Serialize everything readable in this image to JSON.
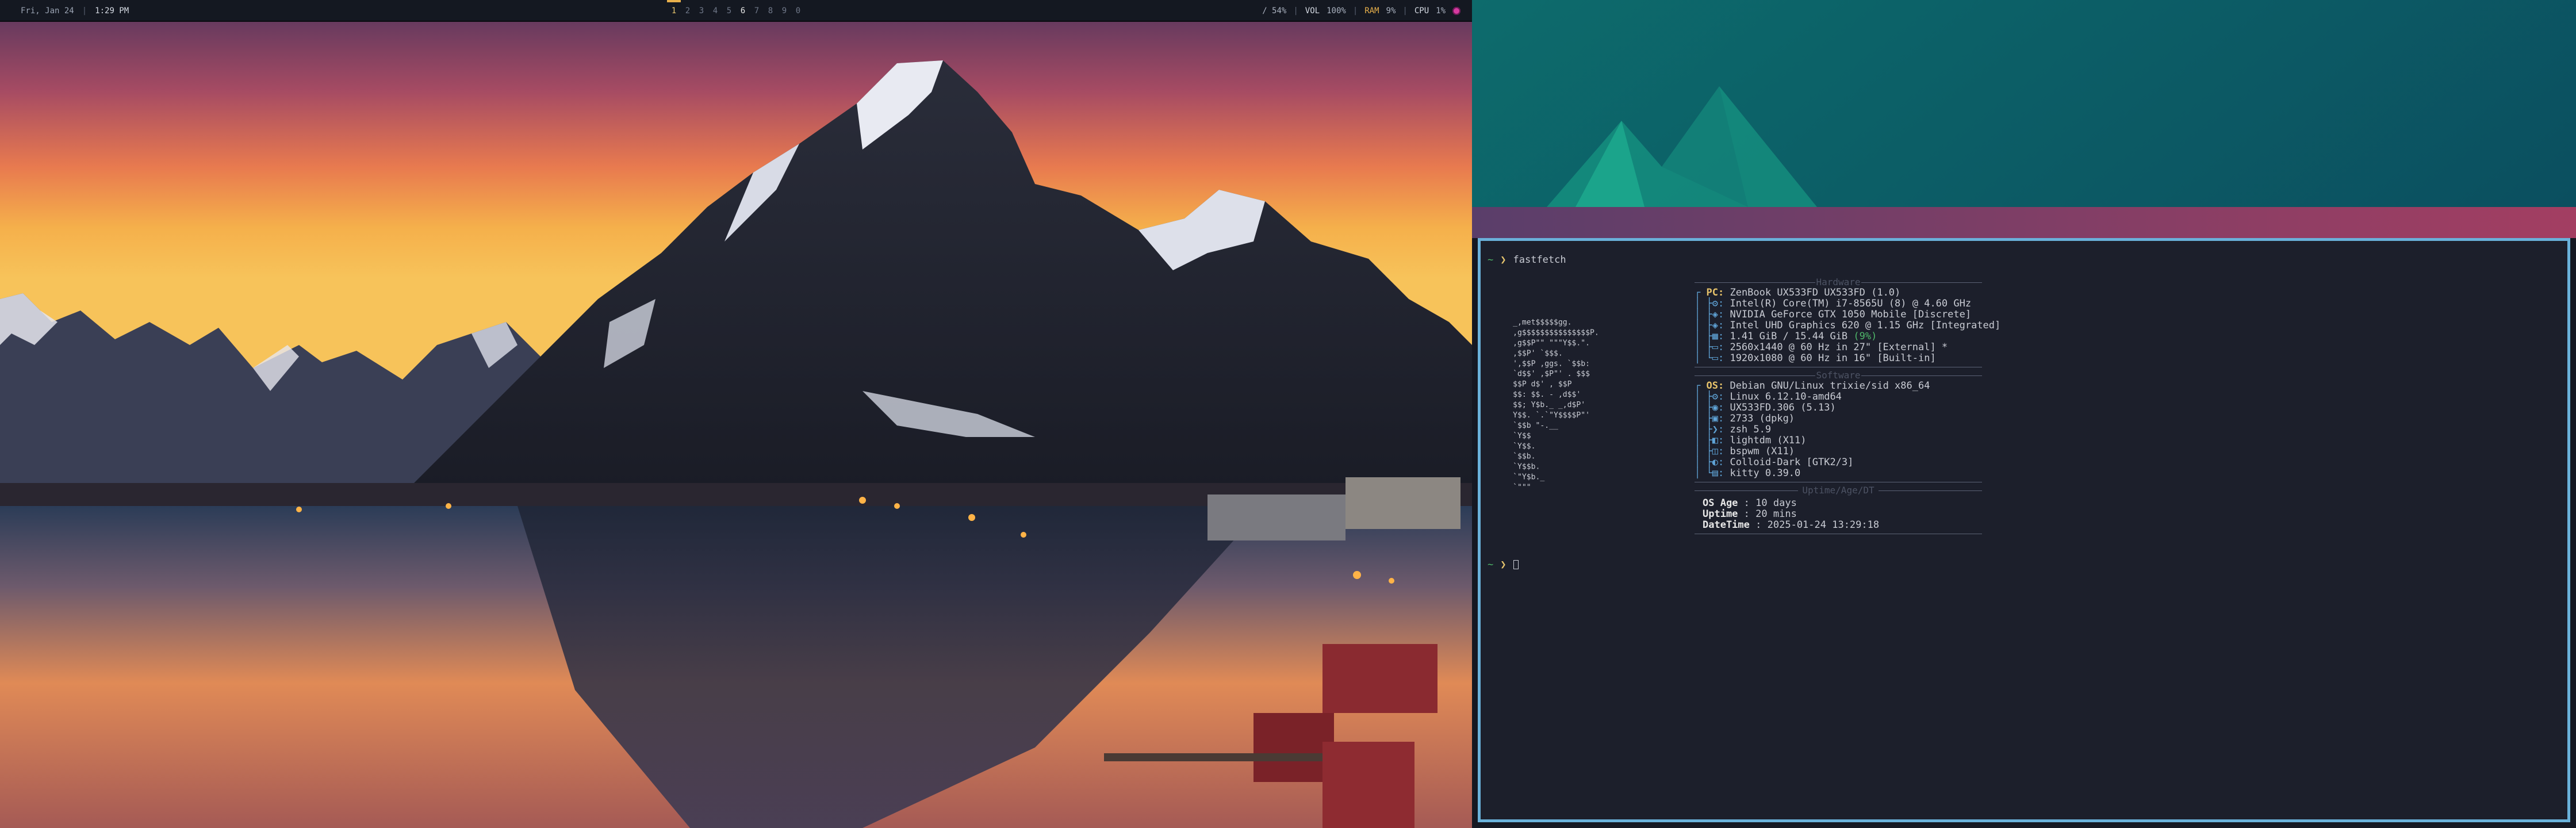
{
  "statusbar": {
    "date": "Fri, Jan 24",
    "separator": "|",
    "time": "1:29 PM",
    "workspaces": [
      {
        "label": "1",
        "state": "active"
      },
      {
        "label": "2",
        "state": "empty"
      },
      {
        "label": "3",
        "state": "empty"
      },
      {
        "label": "4",
        "state": "empty"
      },
      {
        "label": "5",
        "state": "empty"
      },
      {
        "label": "6",
        "state": "occupied"
      },
      {
        "label": "7",
        "state": "empty"
      },
      {
        "label": "8",
        "state": "empty"
      },
      {
        "label": "9",
        "state": "empty"
      },
      {
        "label": "0",
        "state": "empty"
      }
    ],
    "brightness": "/ 54%",
    "volume_label": "VOL",
    "volume_value": "100%",
    "ram_label": "RAM",
    "ram_value": "9%",
    "cpu_label": "CPU",
    "cpu_value": "1%",
    "power_icon": "power-icon"
  },
  "terminal": {
    "prompt_symbol": "~",
    "prompt_arrow": "❯",
    "command": "fastfetch",
    "hardware_title": "Hardware",
    "software_title": "Software",
    "uptime_title": "Uptime/Age/DT",
    "hardware": [
      {
        "tree": "┌",
        "key": "PC:",
        "value": "ZenBook UX533FD UX533FD (1.0)"
      },
      {
        "tree": "│ ├",
        "key": "",
        "value": "Intel(R) Core(TM) i7-8565U (8) @ 4.60 GHz"
      },
      {
        "tree": "│ ├",
        "key": "",
        "value": "NVIDIA GeForce GTX 1050 Mobile [Discrete]"
      },
      {
        "tree": "│ ├",
        "key": "",
        "value": "Intel UHD Graphics 620 @ 1.15 GHz [Integrated]"
      },
      {
        "tree": "│ ├",
        "key": "",
        "value": "1.41 GiB / 15.44 GiB",
        "highlight": "(9%)"
      },
      {
        "tree": "│ ├",
        "key": "",
        "value": "2560x1440 @ 60 Hz in 27\" [External] *"
      },
      {
        "tree": "│ └",
        "key": "",
        "value": "1920x1080 @ 60 Hz in 16\" [Built-in]"
      }
    ],
    "software": [
      {
        "tree": "┌",
        "key": "OS:",
        "value": "Debian GNU/Linux trixie/sid x86_64"
      },
      {
        "tree": "│ ├",
        "key": "",
        "value": "Linux 6.12.10-amd64"
      },
      {
        "tree": "│ ├",
        "key": "",
        "value": "UX533FD.306 (5.13)"
      },
      {
        "tree": "│ ├",
        "key": "",
        "value": "2733 (dpkg)"
      },
      {
        "tree": "│ ├",
        "key": "",
        "value": "zsh 5.9"
      },
      {
        "tree": "│ ├",
        "key": "",
        "value": "lightdm (X11)"
      },
      {
        "tree": "│ ├",
        "key": "",
        "value": "bspwm (X11)"
      },
      {
        "tree": "│ ├",
        "key": "",
        "value": "Colloid-Dark [GTK2/3]"
      },
      {
        "tree": "│ └",
        "key": "",
        "value": "kitty 0.39.0"
      }
    ],
    "uptime": [
      {
        "key": "OS Age",
        "sep": ":",
        "value": "10 days"
      },
      {
        "key": "Uptime",
        "sep": ":",
        "value": "20 mins"
      },
      {
        "key": "DateTime",
        "sep": ":",
        "value": "2025-01-24 13:29:18"
      }
    ],
    "logo_lines": [
      "       _,met$$$$$gg.",
      "    ,g$$$$$$$$$$$$$$$P.",
      "  ,g$$P\"\"       \"\"\"Y$$.\".",
      " ,$$P'              `$$$.",
      "',$$P       ,ggs.     `$$b:",
      "`d$$'     ,$P\"'   .    $$$",
      " $$P      d$'     ,    $$P",
      " $$:      $$.   -    ,d$$'",
      " $$;      Y$b._   _,d$P'",
      " Y$$.    `.`\"Y$$$$P\"'",
      " `$$b      \"-.__",
      "  `Y$$",
      "   `Y$$.",
      "     `$$b.",
      "       `Y$$b.",
      "          `\"Y$b._",
      "              `\"\"\""
    ]
  },
  "colors": {
    "terminal_bg": "#1c1f2b",
    "terminal_border": "#6ab1da",
    "accent_yellow": "#e8b04b",
    "accent_green": "#4fb86a",
    "tree_blue": "#5fa3d6"
  }
}
